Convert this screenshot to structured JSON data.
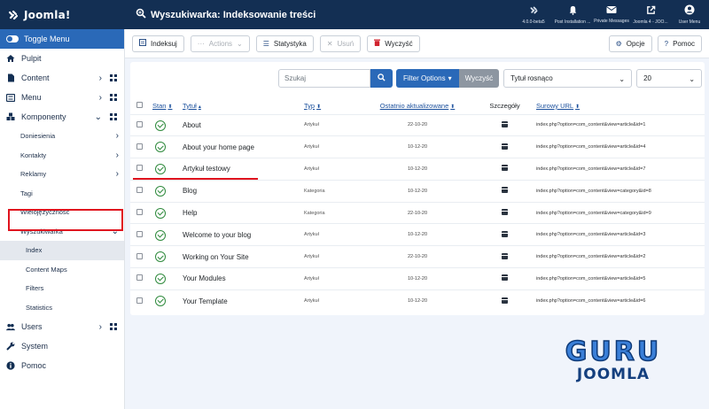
{
  "header": {
    "logo_text": "Joomla!",
    "page_title": "Wyszukiwarka: Indeksowanie treści",
    "items": [
      {
        "label": "4.0.0-beta5",
        "icon": "joomla-icon"
      },
      {
        "label": "Post Installation ...",
        "icon": "bell-icon"
      },
      {
        "label": "Private Messages",
        "icon": "envelope-icon"
      },
      {
        "label": "Joomla 4 - JOO...",
        "icon": "external-link-icon"
      },
      {
        "label": "User Menu",
        "icon": "user-icon"
      }
    ]
  },
  "sidebar": {
    "toggle_label": "Toggle Menu",
    "items": [
      {
        "label": "Pulpit"
      },
      {
        "label": "Content"
      },
      {
        "label": "Menu"
      },
      {
        "label": "Komponenty"
      }
    ],
    "subitems": [
      {
        "label": "Doniesienia"
      },
      {
        "label": "Kontakty"
      },
      {
        "label": "Reklamy"
      },
      {
        "label": "Tagi"
      },
      {
        "label": "Wielojęzyczność"
      },
      {
        "label": "Wyszukiwarka"
      }
    ],
    "finder_items": [
      {
        "label": "Index"
      },
      {
        "label": "Content Maps"
      },
      {
        "label": "Filters"
      },
      {
        "label": "Statistics"
      }
    ],
    "bottom_items": [
      {
        "label": "Users"
      },
      {
        "label": "System"
      },
      {
        "label": "Pomoc"
      }
    ]
  },
  "toolbar": {
    "index_label": "Indeksuj",
    "actions_label": "Actions",
    "stats_label": "Statystyka",
    "delete_label": "Usuń",
    "clear_label": "Wyczyść",
    "options_label": "Opcje",
    "help_label": "Pomoc"
  },
  "filters": {
    "search_placeholder": "Szukaj",
    "filter_options_label": "Filter Options",
    "clear_label": "Wyczyść",
    "ordering_value": "Tytuł rosnąco",
    "limit_value": "20"
  },
  "table": {
    "headers": {
      "stan": "Stan",
      "title": "Tytuł",
      "type": "Typ",
      "updated": "Ostatnio aktualizowane",
      "details": "Szczegóły",
      "url": "Surowy URL"
    },
    "rows": [
      {
        "title": "About",
        "type": "Artykuł",
        "date": "22-10-20",
        "url": "index.php?option=com_content&view=article&id=1"
      },
      {
        "title": "About your home page",
        "type": "Artykuł",
        "date": "10-12-20",
        "url": "index.php?option=com_content&view=article&id=4"
      },
      {
        "title": "Artykuł testowy",
        "type": "Artykuł",
        "date": "10-12-20",
        "url": "index.php?option=com_content&view=article&id=7"
      },
      {
        "title": "Blog",
        "type": "Kategoria",
        "date": "10-12-20",
        "url": "index.php?option=com_content&view=category&id=8"
      },
      {
        "title": "Help",
        "type": "Kategoria",
        "date": "22-10-20",
        "url": "index.php?option=com_content&view=category&id=9"
      },
      {
        "title": "Welcome to your blog",
        "type": "Artykuł",
        "date": "10-12-20",
        "url": "index.php?option=com_content&view=article&id=3"
      },
      {
        "title": "Working on Your Site",
        "type": "Artykuł",
        "date": "22-10-20",
        "url": "index.php?option=com_content&view=article&id=2"
      },
      {
        "title": "Your Modules",
        "type": "Artykuł",
        "date": "10-12-20",
        "url": "index.php?option=com_content&view=article&id=5"
      },
      {
        "title": "Your Template",
        "type": "Artykuł",
        "date": "10-12-20",
        "url": "index.php?option=com_content&view=article&id=6"
      }
    ]
  },
  "watermark": {
    "line1": "GURU",
    "line2": "JOOMLA"
  },
  "colors": {
    "header": "#132f53",
    "accent": "#2a69b8",
    "highlight": "#e0141e",
    "published": "#2f8a3d"
  }
}
